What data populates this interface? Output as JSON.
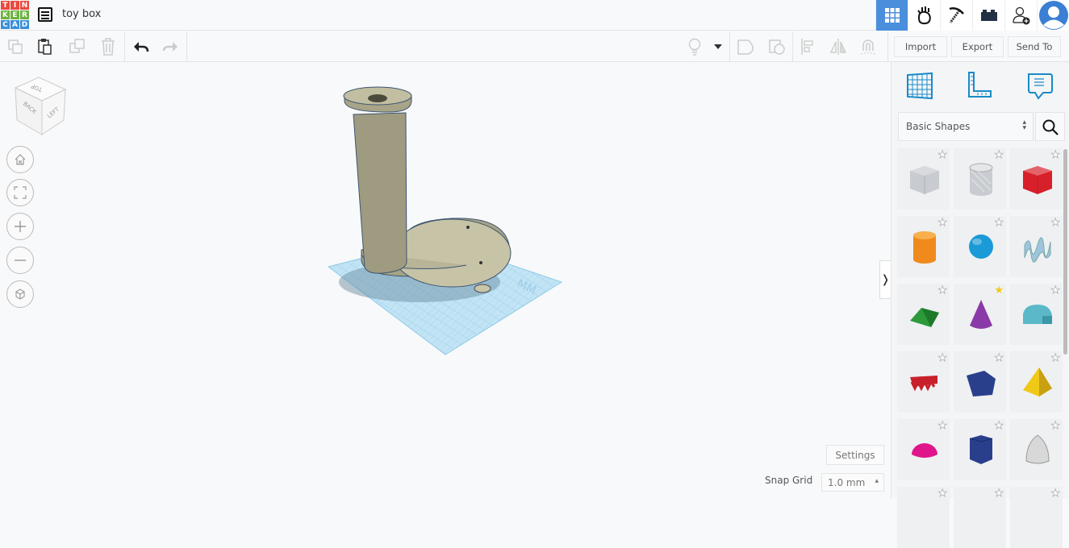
{
  "header": {
    "logo_letters": [
      "T",
      "I",
      "N",
      "K",
      "E",
      "R",
      "C",
      "A",
      "D"
    ],
    "logo_colors": [
      "#e84a3c",
      "#e84a3c",
      "#e84a3c",
      "#6db33f",
      "#6db33f",
      "#6db33f",
      "#3a8fd8",
      "#3a8fd8",
      "#3a8fd8"
    ],
    "title": "toy box",
    "nav_icons": [
      "3d-design-grid-icon",
      "circuits-hand-icon",
      "minecraft-pickaxe-icon",
      "brick-icon",
      "add-user-icon",
      "avatar-icon"
    ],
    "active_color": "#4a8fdc"
  },
  "toolbar": {
    "import": "Import",
    "export": "Export",
    "send_to": "Send To"
  },
  "panel": {
    "category": "Basic Shapes",
    "shapes": [
      {
        "icon": "box-icon",
        "color": "#c8cbd0",
        "starred": false
      },
      {
        "icon": "cylinder-hole-icon",
        "color": "#c8cbd0",
        "starred": false
      },
      {
        "icon": "box-icon",
        "color": "#d8202a",
        "starred": false
      },
      {
        "icon": "cylinder-icon",
        "color": "#f08a1c",
        "starred": false
      },
      {
        "icon": "sphere-icon",
        "color": "#1a9ad6",
        "starred": false
      },
      {
        "icon": "scribble-icon",
        "color": "#9fc4dc",
        "starred": false
      },
      {
        "icon": "roof-icon",
        "color": "#2c9a3a",
        "starred": false
      },
      {
        "icon": "cone-icon",
        "color": "#8a3aa8",
        "starred": true
      },
      {
        "icon": "round-roof-icon",
        "color": "#5ab8c8",
        "starred": false
      },
      {
        "icon": "text-icon",
        "color": "#c8202a",
        "starred": false
      },
      {
        "icon": "polygon-icon",
        "color": "#2a3f8c",
        "starred": false
      },
      {
        "icon": "pyramid-icon",
        "color": "#f0c818",
        "starred": false
      },
      {
        "icon": "half-sphere-icon",
        "color": "#e0158a",
        "starred": false
      },
      {
        "icon": "hexagonal-prism-icon",
        "color": "#2a3f8c",
        "starred": false
      },
      {
        "icon": "paraboloid-icon",
        "color": "#d8d8d8",
        "starred": false
      }
    ]
  },
  "viewcube": {
    "top": "TOP",
    "back": "BACK",
    "left": "LEFT"
  },
  "footer": {
    "settings": "Settings",
    "snap_label": "Snap Grid",
    "snap_value": "1.0 mm"
  }
}
